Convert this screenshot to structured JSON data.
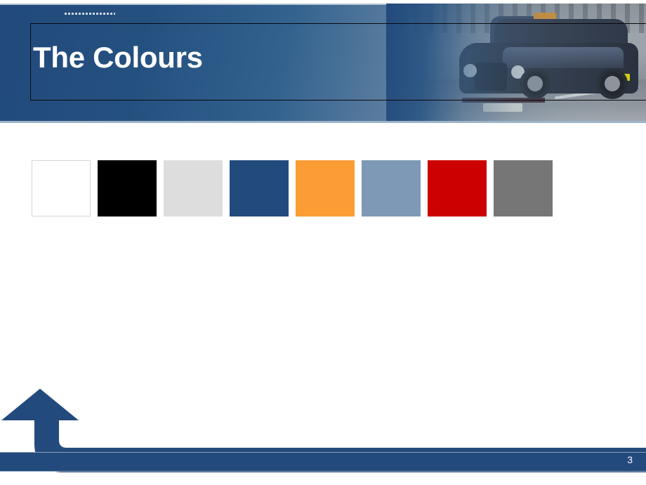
{
  "slide": {
    "title": "The Colours",
    "page_number": "3",
    "eyebrow_text": "",
    "header_image_alt": "london-black-taxi-photo"
  },
  "theme": {
    "brand_blue": "#234a7c",
    "header_gradient_start": "#224a7c",
    "header_gradient_end": "#a6b4c2",
    "footer_bar_color": "#234a7c",
    "arrow_color": "#234a7c",
    "title_color": "#ffffff",
    "title_box_border": "#0a0a0a"
  },
  "palette": {
    "label": "The Colours",
    "swatches": [
      {
        "name": "white",
        "hex": "#ffffff",
        "bordered": true
      },
      {
        "name": "black",
        "hex": "#000000",
        "bordered": false
      },
      {
        "name": "light-grey",
        "hex": "#dddddd",
        "bordered": false
      },
      {
        "name": "dark-blue",
        "hex": "#234a7c",
        "bordered": false
      },
      {
        "name": "orange",
        "hex": "#fb9c35",
        "bordered": false
      },
      {
        "name": "steel-blue",
        "hex": "#7e99b5",
        "bordered": false
      },
      {
        "name": "red",
        "hex": "#cc0000",
        "bordered": false
      },
      {
        "name": "grey",
        "hex": "#767676",
        "bordered": false
      }
    ]
  }
}
